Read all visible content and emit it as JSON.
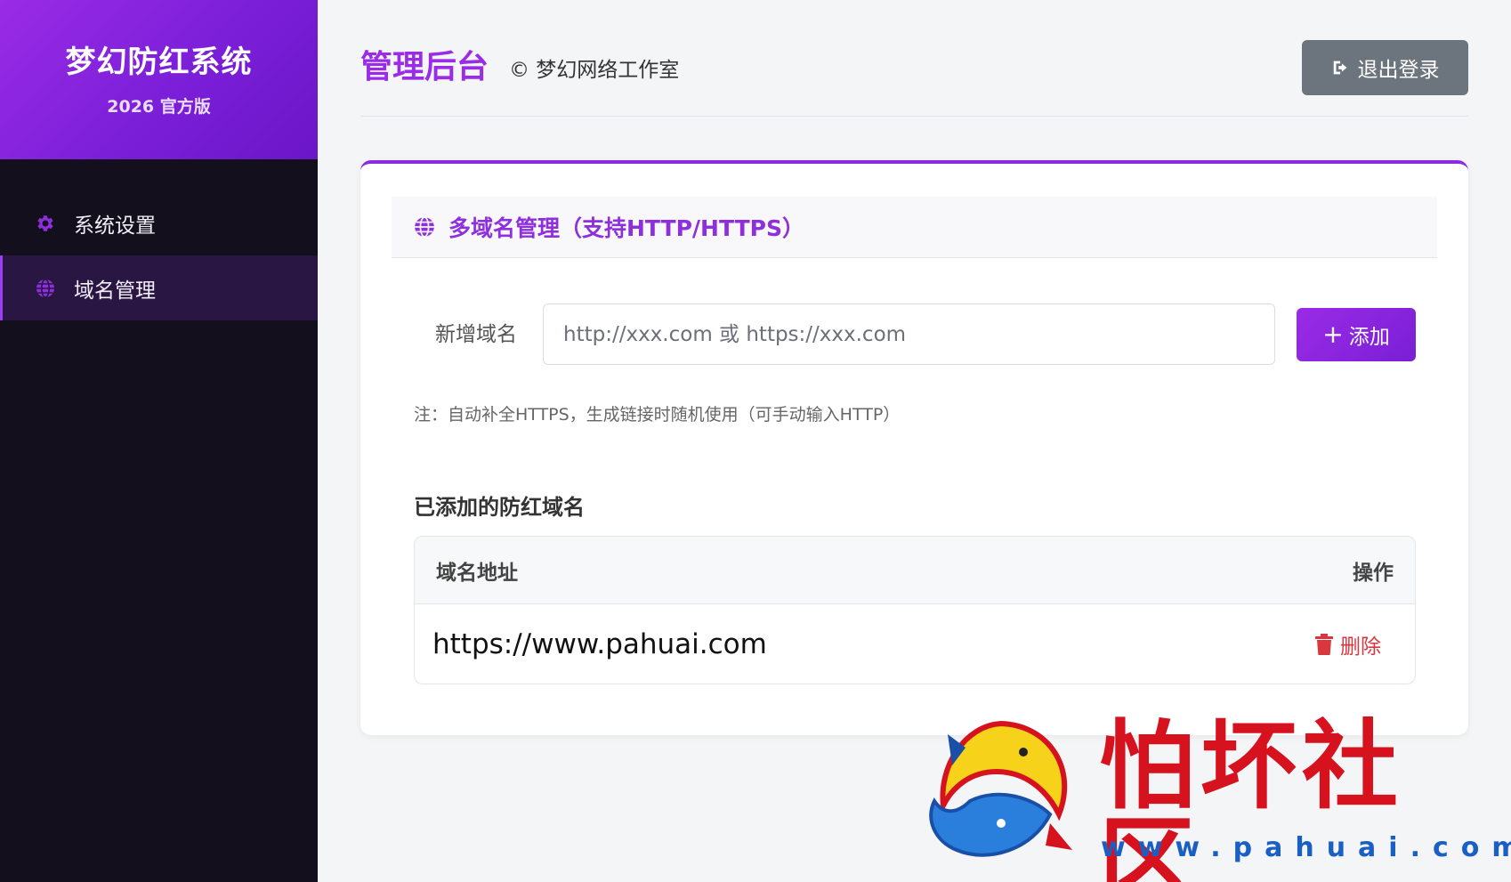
{
  "sidebar": {
    "brand_title": "梦幻防红系统",
    "brand_subtitle": "2026 官方版",
    "items": [
      {
        "label": "系统设置",
        "icon": "gear-icon",
        "active": false
      },
      {
        "label": "域名管理",
        "icon": "globe-icon",
        "active": true
      }
    ]
  },
  "header": {
    "title": "管理后台",
    "copyright": "© 梦幻网络工作室",
    "logout_label": "退出登录"
  },
  "card": {
    "title": "多域名管理（支持HTTP/HTTPS）",
    "new_domain_label": "新增域名",
    "input_placeholder": "http://xxx.com 或 https://xxx.com",
    "input_value": "",
    "add_label": "添加",
    "note": "注：自动补全HTTPS，生成链接时随机使用（可手动输入HTTP）",
    "list_title": "已添加的防红域名",
    "table": {
      "headers": [
        "域名地址",
        "操作"
      ],
      "rows": [
        {
          "domain": "https://www.pahuai.com",
          "action": "删除"
        }
      ]
    }
  },
  "watermark": {
    "text": "怕坏社区",
    "url": "www.pahuai.com"
  },
  "colors": {
    "accent": "#9a2be6",
    "sidebar_bg": "#130f1d",
    "logout_bg": "#6c757d",
    "danger": "#d9363e"
  }
}
